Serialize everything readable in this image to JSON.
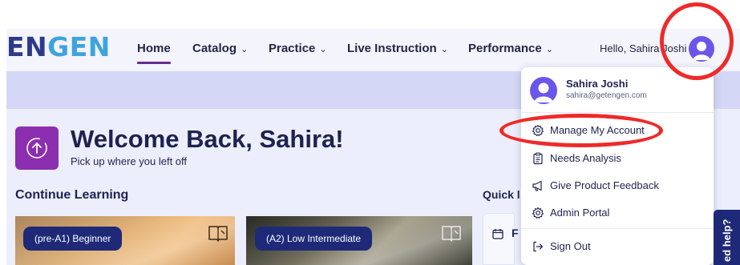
{
  "app": {
    "logo_left": "EN",
    "logo_right": "GEN"
  },
  "nav": {
    "items": [
      {
        "label": "Home",
        "has_chevron": false,
        "active": true
      },
      {
        "label": "Catalog",
        "has_chevron": true
      },
      {
        "label": "Practice",
        "has_chevron": true
      },
      {
        "label": "Live Instruction",
        "has_chevron": true
      },
      {
        "label": "Performance",
        "has_chevron": true
      }
    ],
    "chevron": "⌄",
    "greeting": "Hello, Sahira Joshi"
  },
  "welcome": {
    "title": "Welcome Back, Sahira!",
    "subtitle": "Pick up where you left off"
  },
  "continue_learning": {
    "title": "Continue Learning",
    "cards": [
      {
        "level": "(pre-A1) Beginner"
      },
      {
        "level": "(A2) Low Intermediate"
      }
    ]
  },
  "quick": {
    "title_fragment": "Quick l",
    "item_fragment": "F"
  },
  "help_tab": {
    "label": "ed help?"
  },
  "account_menu": {
    "name": "Sahira Joshi",
    "email": "sahira@getengen.com",
    "items": [
      {
        "label": "Manage My Account",
        "icon": "gear-icon"
      },
      {
        "label": "Needs Analysis",
        "icon": "clipboard-icon"
      },
      {
        "label": "Give Product Feedback",
        "icon": "megaphone-icon"
      },
      {
        "label": "Admin Portal",
        "icon": "gear-icon"
      },
      {
        "label": "Sign Out",
        "icon": "sign-out-icon"
      }
    ]
  },
  "colors": {
    "brand_navy": "#1e2a78",
    "brand_purple": "#8b2fb0",
    "active_underline": "#6a2c8c",
    "annotation_red": "#ee2a2a",
    "avatar": "#6a56e8"
  }
}
